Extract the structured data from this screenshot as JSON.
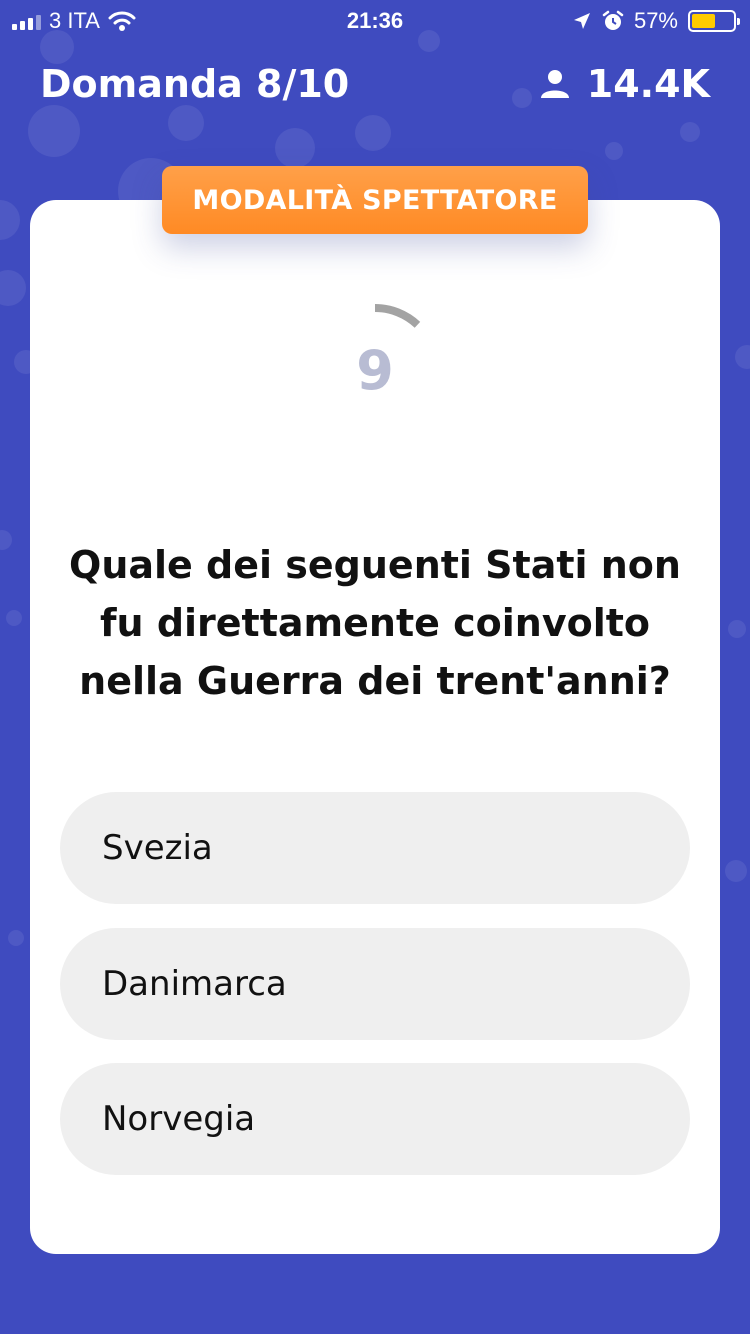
{
  "status_bar": {
    "carrier": "3 ITA",
    "time": "21:36",
    "battery_percent": "57%",
    "battery_level": 0.57,
    "battery_color": "#ffcc00"
  },
  "header": {
    "title": "Domanda 8/10",
    "viewer_count": "14.4K"
  },
  "mode_badge": "MODALITÀ SPETTATORE",
  "timer": {
    "seconds_left": "9",
    "progress": 0.12
  },
  "question": "Quale dei seguenti Stati non fu direttamente coinvolto nella Guerra dei trent'anni?",
  "answers": [
    {
      "label": "Svezia"
    },
    {
      "label": "Danimarca"
    },
    {
      "label": "Norvegia"
    }
  ],
  "colors": {
    "background": "#3f4bbf",
    "accent": "#ff8a24",
    "answer_bg": "#efefef"
  }
}
